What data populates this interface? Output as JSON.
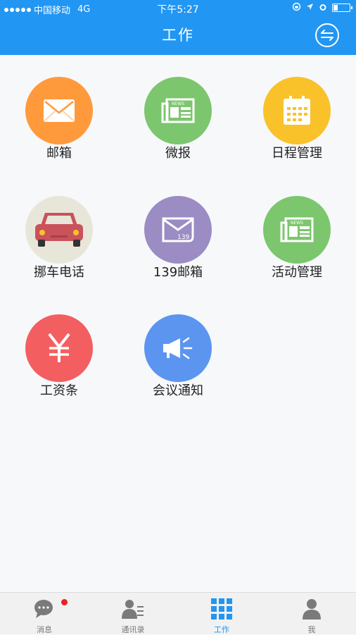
{
  "status_bar": {
    "carrier": "中国移动",
    "network": "4G",
    "time": "下午5:27"
  },
  "header": {
    "title": "工作",
    "switch_icon": "switch-arrows-icon"
  },
  "apps": [
    {
      "label": "邮箱",
      "icon": "mail-icon",
      "color": "#ff9a3c"
    },
    {
      "label": "微报",
      "icon": "news-icon",
      "color": "#7cc66e"
    },
    {
      "label": "日程管理",
      "icon": "calendar-icon",
      "color": "#f9c22b"
    },
    {
      "label": "挪车电话",
      "icon": "car-icon",
      "color": "#e8e6d8"
    },
    {
      "label": "139邮箱",
      "icon": "mail-139-icon",
      "color": "#9b8cc4"
    },
    {
      "label": "活动管理",
      "icon": "news-icon",
      "color": "#7cc66e"
    },
    {
      "label": "工资条",
      "icon": "yen-icon",
      "color": "#f35f60"
    },
    {
      "label": "会议通知",
      "icon": "megaphone-icon",
      "color": "#5b95f0"
    }
  ],
  "tabbar": {
    "tabs": [
      {
        "label": "消息",
        "icon": "chat-icon",
        "badge": true
      },
      {
        "label": "通讯录",
        "icon": "contacts-icon"
      },
      {
        "label": "工作",
        "icon": "grid-icon",
        "active": true
      },
      {
        "label": "我",
        "icon": "person-icon"
      }
    ]
  },
  "colors": {
    "accent": "#2196f3",
    "background": "#f7f8fa",
    "badge": "#f01e1e"
  }
}
